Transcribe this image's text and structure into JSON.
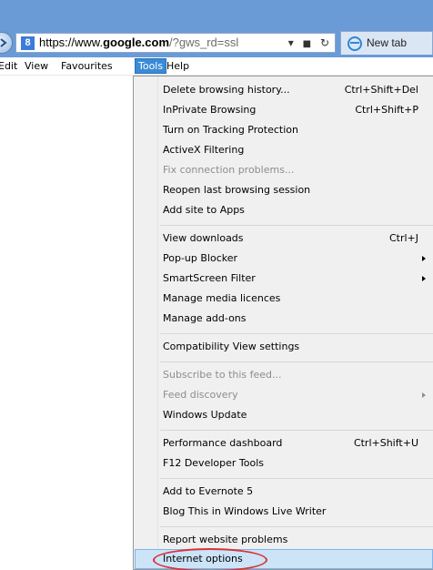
{
  "browser": {
    "address": {
      "scheme": "https://www.",
      "host": "google.com",
      "path": "/?gws_rd=ssl",
      "dropdown_glyph": "▾",
      "lock_glyph": "🔒",
      "refresh_glyph": "↻"
    },
    "tab": {
      "label": "New tab"
    }
  },
  "menubar": {
    "items": [
      {
        "label": "Edit"
      },
      {
        "label": "View"
      },
      {
        "label": "Favourites"
      },
      {
        "label": "Tools"
      },
      {
        "label": "Help"
      }
    ]
  },
  "tools_menu": {
    "items": [
      {
        "label": "Delete browsing history...",
        "shortcut": "Ctrl+Shift+Del"
      },
      {
        "label": "InPrivate Browsing",
        "shortcut": "Ctrl+Shift+P"
      },
      {
        "label": "Turn on Tracking Protection",
        "shortcut": ""
      },
      {
        "label": "ActiveX Filtering",
        "shortcut": ""
      },
      {
        "label": "Fix connection problems...",
        "shortcut": ""
      },
      {
        "label": "Reopen last browsing session",
        "shortcut": ""
      },
      {
        "label": "Add site to Apps",
        "shortcut": ""
      },
      {
        "label": "View downloads",
        "shortcut": "Ctrl+J"
      },
      {
        "label": "Pop-up Blocker",
        "shortcut": ""
      },
      {
        "label": "SmartScreen Filter",
        "shortcut": ""
      },
      {
        "label": "Manage media licences",
        "shortcut": ""
      },
      {
        "label": "Manage add-ons",
        "shortcut": ""
      },
      {
        "label": "Compatibility View settings",
        "shortcut": ""
      },
      {
        "label": "Subscribe to this feed...",
        "shortcut": ""
      },
      {
        "label": "Feed discovery",
        "shortcut": ""
      },
      {
        "label": "Windows Update",
        "shortcut": ""
      },
      {
        "label": "Performance dashboard",
        "shortcut": "Ctrl+Shift+U"
      },
      {
        "label": "F12 Developer Tools",
        "shortcut": ""
      },
      {
        "label": "Add to Evernote 5",
        "shortcut": ""
      },
      {
        "label": "Blog This in Windows Live Writer",
        "shortcut": ""
      },
      {
        "label": "Report website problems",
        "shortcut": ""
      },
      {
        "label": "Internet options",
        "shortcut": ""
      }
    ]
  },
  "colors": {
    "chrome_blue": "#6b9bd6",
    "menu_highlight": "#cce4f7",
    "annotation_red": "#d8343a"
  }
}
